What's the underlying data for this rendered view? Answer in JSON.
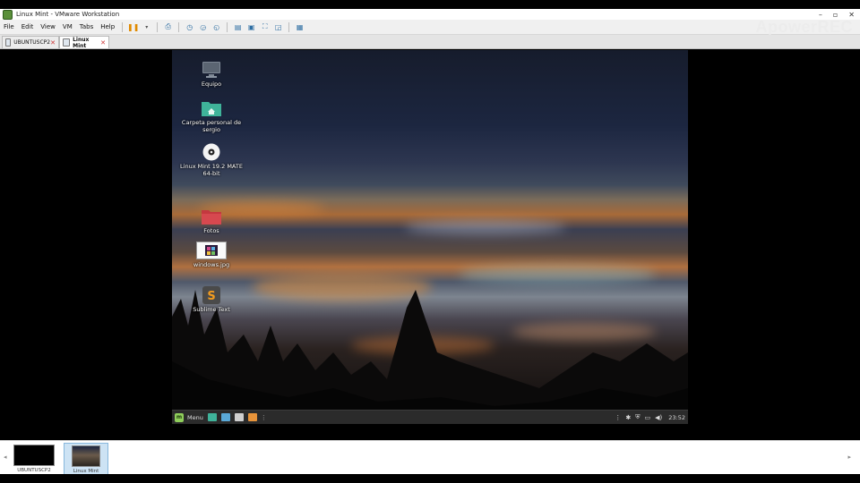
{
  "window": {
    "title": "Linux Mint - VMware Workstation",
    "controls": {
      "minimize": "–",
      "maximize": "▫",
      "close": "✕"
    }
  },
  "menubar": {
    "items": [
      "File",
      "Edit",
      "View",
      "VM",
      "Tabs",
      "Help"
    ]
  },
  "watermark": "ApowerREC",
  "tabs": [
    {
      "label": "UBUNTUSCP2",
      "active": false
    },
    {
      "label": "Linux Mint",
      "active": true
    }
  ],
  "desktop": {
    "icons": [
      {
        "label": "Equipo",
        "icon": "computer-icon"
      },
      {
        "label": "Carpeta personal de sergio",
        "icon": "home-folder-icon"
      },
      {
        "label": "Linux Mint 19.2 MATE 64-bit",
        "icon": "disc-icon"
      },
      {
        "label": "Fotos",
        "icon": "folder-icon"
      },
      {
        "label": "windows.jpg",
        "icon": "image-file-icon"
      },
      {
        "label": "Sublime Text",
        "icon": "sublime-text-icon"
      }
    ]
  },
  "panel": {
    "menu_label": "Menu",
    "clock": "23:52"
  },
  "thumbnails": [
    {
      "label": "UBUNTUSCP2",
      "selected": false
    },
    {
      "label": "Linux Mint",
      "selected": true
    }
  ],
  "colors": {
    "mint_green": "#8fce5b",
    "teal_folder": "#3fb39a",
    "red_folder": "#c4383f",
    "pause_orange": "#e08a00"
  }
}
